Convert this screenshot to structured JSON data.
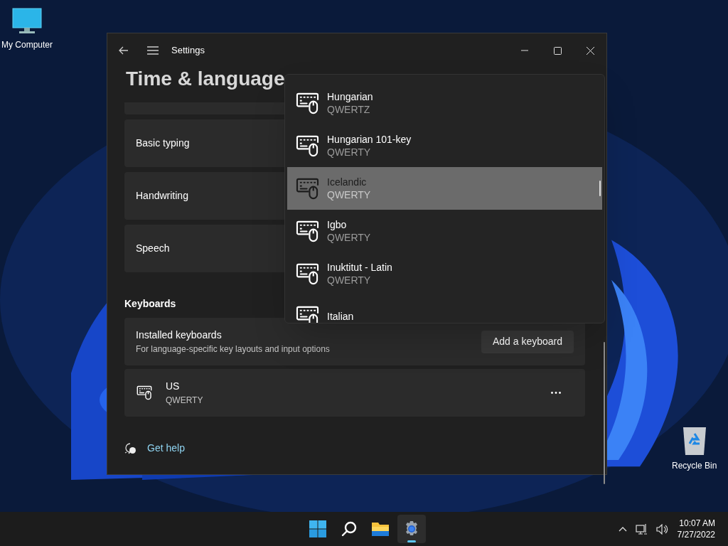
{
  "desktop_icons": [
    {
      "kind": "computer",
      "label": "My Computer"
    },
    {
      "kind": "recycle",
      "label": "Recycle Bin"
    }
  ],
  "window": {
    "title": "Settings",
    "heading": "Time & language"
  },
  "settings_rows": [
    {
      "label": "Basic typing"
    },
    {
      "label": "Handwriting"
    },
    {
      "label": "Speech"
    }
  ],
  "keyboards_section": {
    "title": "Keyboards",
    "installed": {
      "title": "Installed keyboards",
      "description": "For language-specific key layouts and input options",
      "button": "Add a keyboard"
    },
    "keyboards": [
      {
        "name": "US",
        "layout": "QWERTY"
      }
    ]
  },
  "help_link": "Get help",
  "dropdown": {
    "items": [
      {
        "name": "Hungarian",
        "layout": "QWERTZ",
        "selected": false
      },
      {
        "name": "Hungarian 101-key",
        "layout": "QWERTY",
        "selected": false
      },
      {
        "name": "Icelandic",
        "layout": "QWERTY",
        "selected": true
      },
      {
        "name": "Igbo",
        "layout": "QWERTY",
        "selected": false
      },
      {
        "name": "Inuktitut - Latin",
        "layout": "QWERTY",
        "selected": false
      },
      {
        "name": "Italian",
        "selected": false
      }
    ]
  },
  "taskbar": {
    "apps": [
      {
        "kind": "start",
        "selected": false
      },
      {
        "kind": "search",
        "selected": false
      },
      {
        "kind": "explorer",
        "selected": false
      },
      {
        "kind": "settings",
        "selected": true
      }
    ],
    "time": "10:07 AM",
    "date": "7/27/2022"
  }
}
